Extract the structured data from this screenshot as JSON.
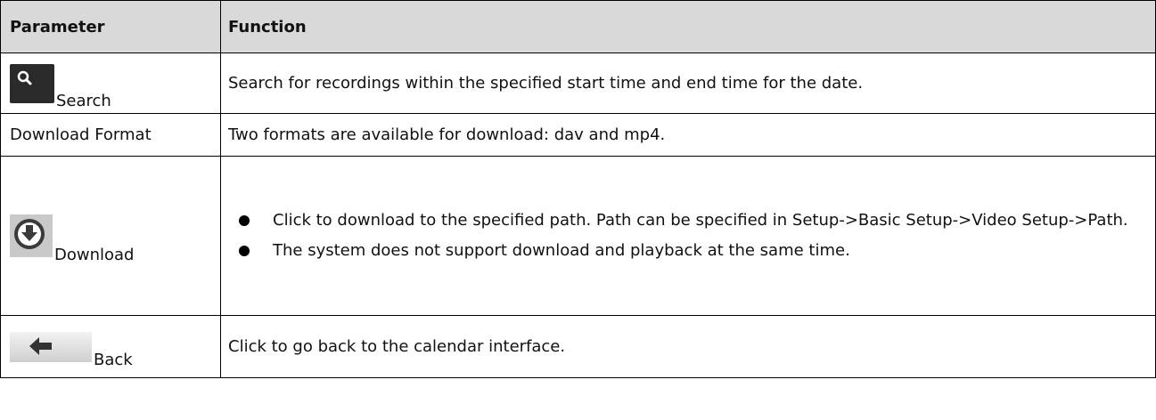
{
  "table": {
    "header": {
      "parameter": "Parameter",
      "function": "Function"
    },
    "rows": [
      {
        "label": "Search",
        "icon": "search-icon",
        "description": "Search for recordings within the specified start time and end time for the date."
      },
      {
        "label": "Download Format",
        "description": "Two formats are available for download:  dav and mp4."
      },
      {
        "label": "Download",
        "icon": "download-icon",
        "bullets": [
          "Click to download to the specified path. Path can be specified in Setup->Basic Setup->Video Setup->Path.",
          "The system does not support download and playback at the same time."
        ]
      },
      {
        "label": "Back",
        "icon": "back-arrow-icon",
        "description": "Click to go back to the calendar interface."
      }
    ]
  },
  "colors": {
    "header_bg": "#d9d9d9",
    "border": "#000000",
    "search_icon_bg": "#2a2a2a"
  }
}
